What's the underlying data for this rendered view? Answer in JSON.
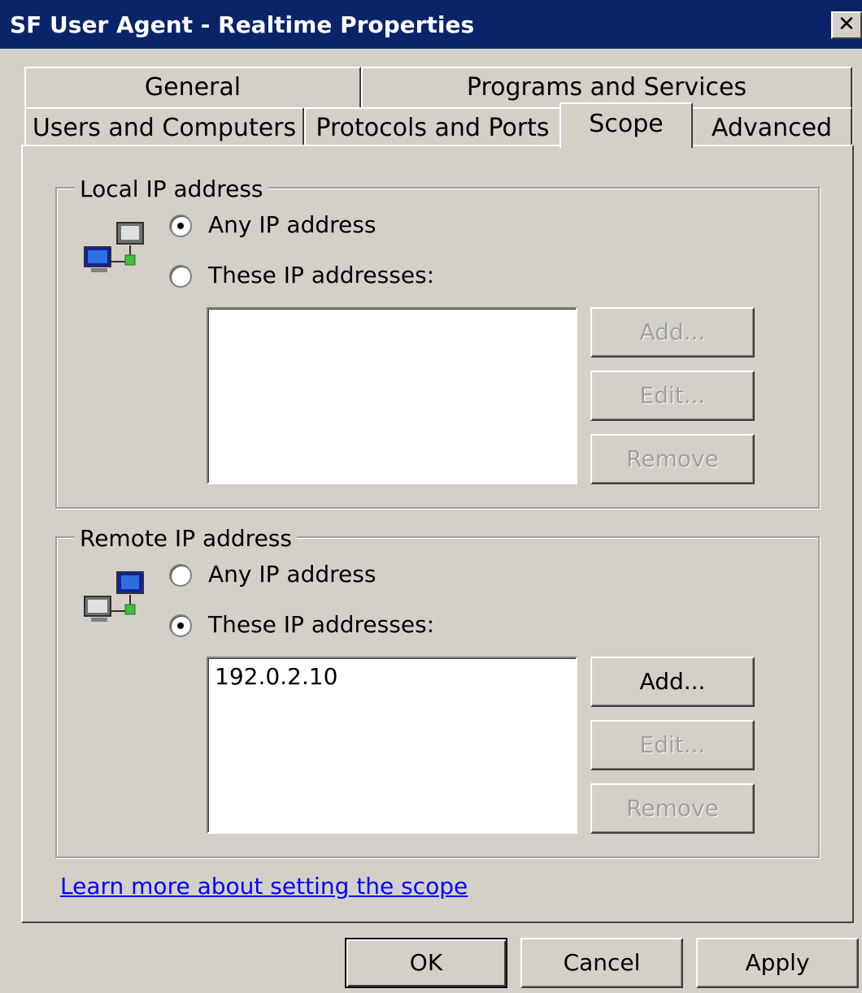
{
  "window": {
    "title": "SF User Agent - Realtime Properties",
    "close_label": "✕"
  },
  "tabs": {
    "general": "General",
    "programs": "Programs and Services",
    "users": "Users and Computers",
    "protocols": "Protocols and Ports",
    "scope": "Scope",
    "advanced": "Advanced",
    "active": "Scope"
  },
  "local": {
    "group_label": "Local IP address",
    "any_label": "Any IP address",
    "these_label": "These IP addresses:",
    "selected": "any",
    "addresses": [],
    "add_label": "Add...",
    "edit_label": "Edit...",
    "remove_label": "Remove",
    "icon": "network-computers-icon"
  },
  "remote": {
    "group_label": "Remote IP address",
    "any_label": "Any IP address",
    "these_label": "These IP addresses:",
    "selected": "these",
    "addresses": [
      "192.0.2.10"
    ],
    "add_label": "Add...",
    "edit_label": "Edit...",
    "remove_label": "Remove",
    "icon": "network-computers-icon"
  },
  "link_text": "Learn more about setting the scope",
  "footer": {
    "ok_label": "OK",
    "cancel_label": "Cancel",
    "apply_label": "Apply"
  },
  "colors": {
    "titlebar": "#0a246a",
    "face": "#d4d0c8",
    "link": "#0000ff"
  }
}
